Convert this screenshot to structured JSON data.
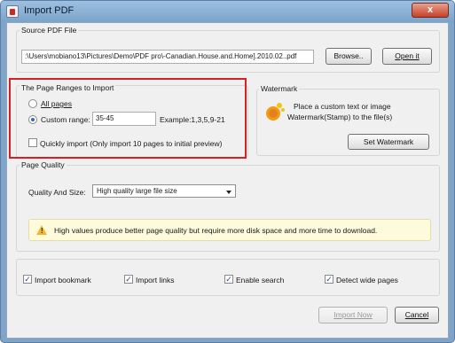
{
  "window": {
    "title": "Import PDF",
    "close_symbol": "x"
  },
  "source": {
    "group_label": "Source PDF File",
    "path": ":\\Users\\mobiano13\\Pictures\\Demo\\PDF pro\\-Canadian.House.and.Home].2010.02..pdf",
    "browse_label": "Browse..",
    "open_label": "Open it"
  },
  "ranges": {
    "group_label": "The Page Ranges to Import",
    "all_pages_label": "All pages",
    "custom_range_label": "Custom range:",
    "custom_range_value": "35-45",
    "example_label": "Example:1,3,5,9-21",
    "quick_import_label": "Quickly import (Only import 10 pages to  initial  preview)",
    "selected": "custom"
  },
  "watermark": {
    "group_label": "Watermark",
    "description_line1": "Place a custom text or image",
    "description_line2": "Watermark(Stamp) to the file(s)",
    "set_button_label": "Set Watermark",
    "icon": "watermark-stamp-icon"
  },
  "quality": {
    "group_label": "Page Quality",
    "size_label": "Quality And Size:",
    "size_value": "High quality large file size",
    "warning_text": "High values produce better page quality but require more disk space and more time to download."
  },
  "options": {
    "import_bookmark": "Import bookmark",
    "import_links": "Import links",
    "enable_search": "Enable search",
    "detect_wide_pages": "Detect wide pages"
  },
  "footer": {
    "import_now_label": "Import Now",
    "cancel_label": "Cancel"
  },
  "colors": {
    "highlight": "#d81f26",
    "titlebar": "#7ba3c9",
    "warning_bg": "#fdfbdc"
  }
}
